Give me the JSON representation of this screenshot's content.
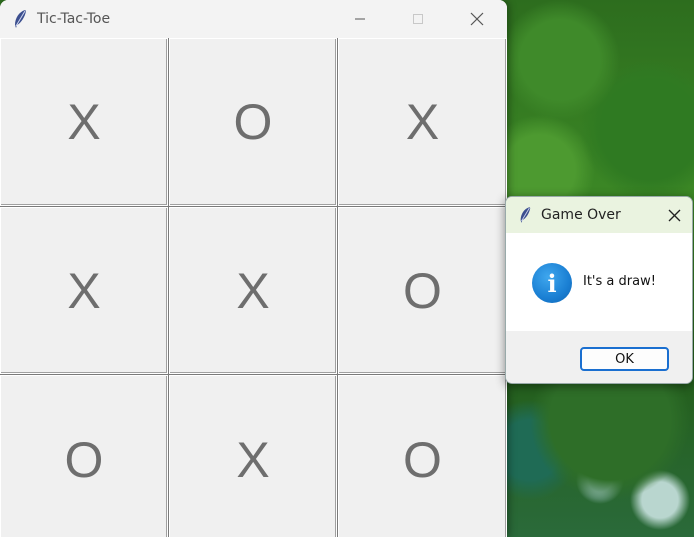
{
  "main_window": {
    "title": "Tic-Tac-Toe",
    "icon": "feather-icon",
    "controls": [
      "minimize-icon",
      "maximize-icon",
      "close-icon"
    ]
  },
  "board": {
    "cells": [
      [
        "X",
        "O",
        "X"
      ],
      [
        "X",
        "X",
        "O"
      ],
      [
        "O",
        "X",
        "O"
      ]
    ]
  },
  "dialog": {
    "title": "Game Over",
    "icon": "info-icon",
    "message": "It's a draw!",
    "ok_label": "OK"
  },
  "colors": {
    "accent": "#1a6fd0",
    "mark": "#6e6e6e",
    "dialog_title_bg": "#eaf3e0"
  }
}
